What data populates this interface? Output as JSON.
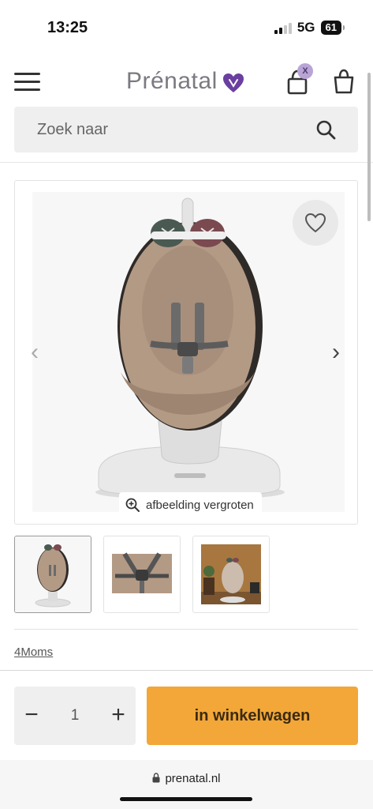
{
  "status_bar": {
    "time": "13:25",
    "network": "5G",
    "battery": "61"
  },
  "header": {
    "logo_text": "Prénatal",
    "account_badge": "X"
  },
  "search": {
    "placeholder": "Zoek naar"
  },
  "product_image": {
    "zoom_label": "afbeelding vergroten",
    "prev_arrow": "‹",
    "next_arrow": "›"
  },
  "thumbnails": [
    {
      "name": "thumbnail-front",
      "active": true
    },
    {
      "name": "thumbnail-harness",
      "active": false
    },
    {
      "name": "thumbnail-room",
      "active": false
    }
  ],
  "brand": "4Moms",
  "cart": {
    "quantity": "1",
    "minus_label": "−",
    "plus_label": "+",
    "add_label": "in winkelwagen"
  },
  "browser": {
    "url": "prenatal.nl"
  },
  "colors": {
    "accent": "#f2a738",
    "logo_heart": "#6a3fa0",
    "badge": "#b9a4d6",
    "seat": "#b39a85"
  }
}
